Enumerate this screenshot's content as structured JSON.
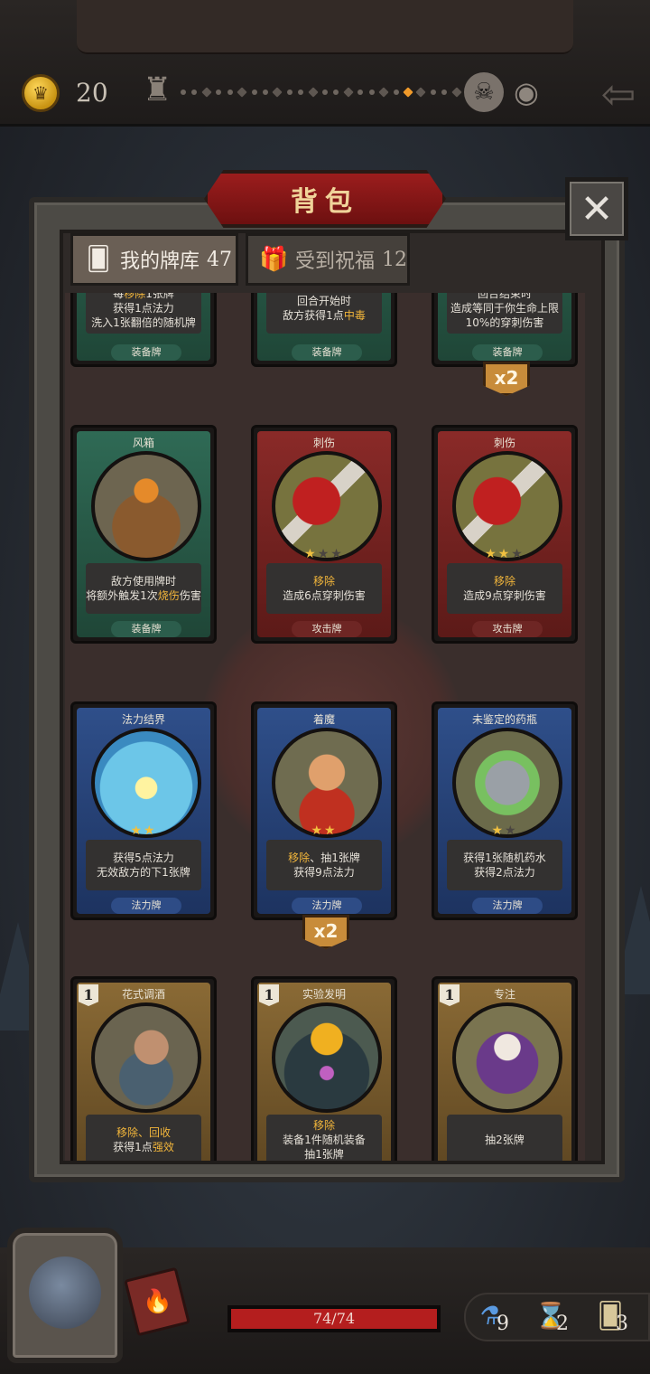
{
  "top_bar": {
    "coins": "20",
    "progress": {
      "total_nodes": 24,
      "current_index": 19
    }
  },
  "modal": {
    "title": "背包",
    "close_icon": "close-icon",
    "tabs": [
      {
        "label": "我的牌库",
        "count": "47",
        "icon": "cards-icon",
        "active": true
      },
      {
        "label": "受到祝福",
        "count": "12",
        "icon": "gift-icon",
        "active": false
      }
    ]
  },
  "cards": {
    "row0": [
      {
        "desc_lines": [
          "每",
          "移除",
          "1张牌"
        ],
        "desc2": "获得1点法力",
        "desc3": "洗入1张翻倍的随机牌",
        "type": "装备牌"
      },
      {
        "desc1": "回合开始时",
        "desc2a": "敌方获得1点",
        "desc2b": "中毒",
        "type": "装备牌"
      },
      {
        "desc1": "回合结束时",
        "desc2": "造成等同于你生命上限",
        "desc3": "10%的穿刺伤害",
        "type": "装备牌",
        "multiplier": "x2"
      }
    ],
    "row1": [
      {
        "name": "风箱",
        "desc1": "敌方使用牌时",
        "desc2a": "将额外触发1次",
        "desc2b": "烧伤",
        "desc2c": "伤害",
        "type": "装备牌"
      },
      {
        "name": "刺伤",
        "stars": 1,
        "desc1": "移除",
        "desc2": "造成6点穿刺伤害",
        "type": "攻击牌"
      },
      {
        "name": "刺伤",
        "stars": 2,
        "desc1": "移除",
        "desc2": "造成9点穿刺伤害",
        "type": "攻击牌"
      }
    ],
    "row2": [
      {
        "name": "法力结界",
        "stars": 2,
        "desc1": "获得5点法力",
        "desc2": "无效敌方的下1张牌",
        "type": "法力牌"
      },
      {
        "name": "着魔",
        "stars": 2,
        "desc1a": "移除",
        "desc1b": "、抽1张牌",
        "desc2": "获得9点法力",
        "type": "法力牌",
        "multiplier": "x2"
      },
      {
        "name": "未鉴定的药瓶",
        "stars": 1,
        "desc1": "获得1张随机药水",
        "desc2": "获得2点法力",
        "type": "法力牌"
      }
    ],
    "row3": [
      {
        "name": "花式调酒",
        "cost": "1",
        "desc1": "移除、回收",
        "desc2a": "获得1点",
        "desc2b": "强效"
      },
      {
        "name": "实验发明",
        "cost": "1",
        "desc1": "移除",
        "desc2": "装备1件随机装备",
        "desc3": "抽1张牌"
      },
      {
        "name": "专注",
        "cost": "1",
        "desc1": "抽2张牌"
      }
    ]
  },
  "bottom_bar": {
    "hp_text": "74/74",
    "hp_fraction": 1.0,
    "potions": "9",
    "hourglass": "2",
    "cards": "3"
  }
}
